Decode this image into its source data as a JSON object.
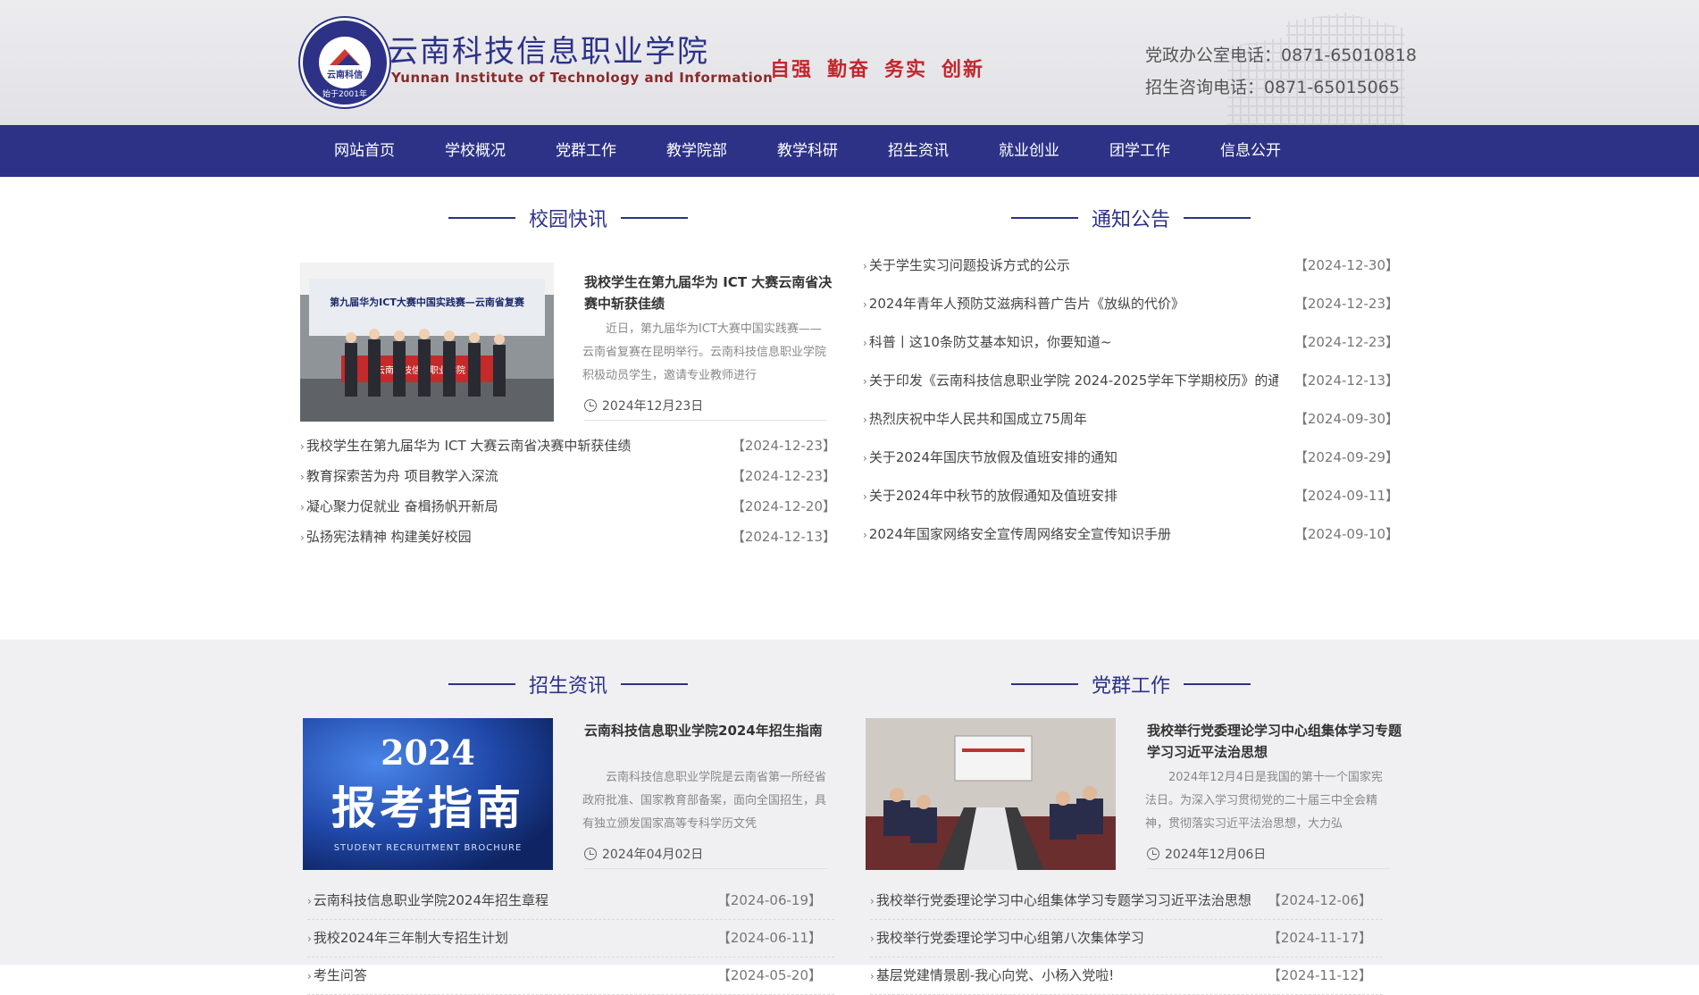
{
  "header": {
    "logo_text": "云南科信",
    "logo_ring": "始于2001年",
    "school_cn": "云南科技信息职业学院",
    "school_en": "Yunnan  Institute of  Technology and  Information",
    "motto": [
      "自强",
      "勤奋",
      "务实",
      "创新"
    ],
    "phone_office": "党政办公室电话：0871-65010818",
    "phone_admission": "招生咨询电话：0871-65015065"
  },
  "nav": [
    "网站首页",
    "学校概况",
    "党群工作",
    "教学院部",
    "教学科研",
    "招生资讯",
    "就业创业",
    "团学工作",
    "信息公开"
  ],
  "campus_news": {
    "heading": "校园快讯",
    "featured": {
      "banner": "第九届华为ICT大赛中国实践赛—云南省复赛",
      "flag": "云南科技信息职业学院",
      "title": "我校学生在第九届华为 ICT 大赛云南省决赛中斩获佳绩",
      "desc": "近日，第九届华为ICT大赛中国实践赛——云南省复赛在昆明举行。云南科技信息职业学院积极动员学生，邀请专业教师进行",
      "date": "2024年12月23日"
    },
    "items": [
      {
        "title": "我校学生在第九届华为 ICT 大赛云南省决赛中斩获佳绩",
        "date": "【2024-12-23】"
      },
      {
        "title": "教育探索苦为舟 项目教学入深流",
        "date": "【2024-12-23】"
      },
      {
        "title": "凝心聚力促就业 奋楫扬帆开新局",
        "date": "【2024-12-20】"
      },
      {
        "title": "弘扬宪法精神 构建美好校园",
        "date": "【2024-12-13】"
      }
    ]
  },
  "notices": {
    "heading": "通知公告",
    "items": [
      {
        "title": "关于学生实习问题投诉方式的公示",
        "date": "【2024-12-30】"
      },
      {
        "title": "2024年青年人预防艾滋病科普广告片《放纵的代价》",
        "date": "【2024-12-23】"
      },
      {
        "title": "科普丨这10条防艾基本知识，你要知道~",
        "date": "【2024-12-23】"
      },
      {
        "title": "关于印发《云南科技信息职业学院 2024-2025学年下学期校历》的通",
        "date": "【2024-12-13】"
      },
      {
        "title": "热烈庆祝中华人民共和国成立75周年",
        "date": "【2024-09-30】"
      },
      {
        "title": "关于2024年国庆节放假及值班安排的通知",
        "date": "【2024-09-29】"
      },
      {
        "title": "关于2024年中秋节的放假通知及值班安排",
        "date": "【2024-09-11】"
      },
      {
        "title": "2024年国家网络安全宣传周网络安全宣传知识手册",
        "date": "【2024-09-10】"
      }
    ]
  },
  "admissions": {
    "heading": "招生资讯",
    "featured": {
      "img_year": "2024",
      "img_title": "报考指南",
      "img_sub": "STUDENT RECRUITMENT BROCHURE",
      "title": "云南科技信息职业学院2024年招生指南",
      "desc": "云南科技信息职业学院是云南省第一所经省政府批准、国家教育部备案，面向全国招生，具有独立颁发国家高等专科学历文凭",
      "date": "2024年04月02日"
    },
    "items": [
      {
        "title": "云南科技信息职业学院2024年招生章程",
        "date": "【2024-06-19】"
      },
      {
        "title": "我校2024年三年制大专招生计划",
        "date": "【2024-06-11】"
      },
      {
        "title": "考生问答",
        "date": "【2024-05-20】"
      }
    ]
  },
  "party": {
    "heading": "党群工作",
    "featured": {
      "title": "我校举行党委理论学习中心组集体学习专题学习习近平法治思想",
      "desc": "2024年12月4日是我国的第十一个国家宪法日。为深入学习贯彻党的二十届三中全会精神，贯彻落实习近平法治思想，大力弘",
      "date": "2024年12月06日"
    },
    "items": [
      {
        "title": "我校举行党委理论学习中心组集体学习专题学习习近平法治思想",
        "date": "【2024-12-06】"
      },
      {
        "title": "我校举行党委理论学习中心组第八次集体学习",
        "date": "【2024-11-17】"
      },
      {
        "title": "基层党建情景剧-我心向党、小杨入党啦!",
        "date": "【2024-11-12】"
      }
    ]
  },
  "colors": {
    "primary": "#2d3287",
    "motto": "#c4262e"
  }
}
